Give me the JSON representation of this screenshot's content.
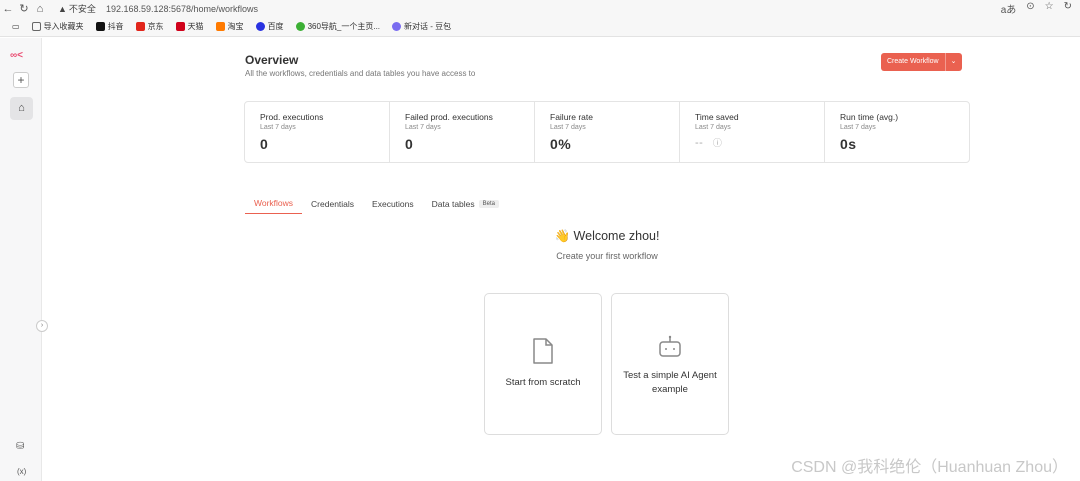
{
  "browser": {
    "insecure_label": "不安全",
    "url": "192.168.59.128:5678/home/workflows",
    "bookmarks": [
      {
        "label": "导入收藏夹",
        "color": "#666666"
      },
      {
        "label": "抖音",
        "color": "#111111"
      },
      {
        "label": "京东",
        "color": "#e1251b"
      },
      {
        "label": "天猫",
        "color": "#d0021b"
      },
      {
        "label": "淘宝",
        "color": "#ff7a00"
      },
      {
        "label": "百度",
        "color": "#2932e1"
      },
      {
        "label": "360导航_一个主页...",
        "color": "#3cb035"
      },
      {
        "label": "新对话 - 豆包",
        "color": "#7a6cf0"
      }
    ]
  },
  "header": {
    "title": "Overview",
    "subtitle": "All the workflows, credentials and data tables you have access to",
    "create_label": "Create Workflow"
  },
  "stats": [
    {
      "label": "Prod. executions",
      "sub": "Last 7 days",
      "value": "0"
    },
    {
      "label": "Failed prod. executions",
      "sub": "Last 7 days",
      "value": "0"
    },
    {
      "label": "Failure rate",
      "sub": "Last 7 days",
      "value": "0%"
    },
    {
      "label": "Time saved",
      "sub": "Last 7 days",
      "value": "--"
    },
    {
      "label": "Run time (avg.)",
      "sub": "Last 7 days",
      "value": "0s"
    }
  ],
  "tabs": [
    {
      "label": "Workflows",
      "active": true
    },
    {
      "label": "Credentials"
    },
    {
      "label": "Executions"
    },
    {
      "label": "Data tables",
      "badge": "Beta"
    }
  ],
  "welcome": {
    "title": "👋 Welcome zhou!",
    "subtitle": "Create your first workflow"
  },
  "cards": [
    {
      "label": "Start from scratch",
      "icon": "file-icon"
    },
    {
      "label": "Test a simple AI Agent example",
      "icon": "robot-icon"
    }
  ],
  "watermark": "CSDN @我科绝伦（Huanhuan Zhou）",
  "colors": {
    "accent": "#ea6150",
    "brand": "#ea4b71"
  }
}
